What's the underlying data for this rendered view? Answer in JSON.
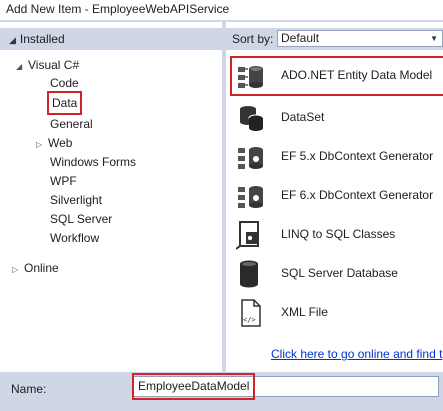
{
  "window": {
    "title": "Add New Item - EmployeeWebAPIService"
  },
  "left_pane": {
    "installed_label": "Installed",
    "tree": {
      "root": "Visual C#",
      "children": [
        "Code",
        "Data",
        "General",
        "Web",
        "Windows Forms",
        "WPF",
        "Silverlight",
        "SQL Server",
        "Workflow"
      ],
      "selected": "Data",
      "online": "Online"
    }
  },
  "right_pane": {
    "sort_label": "Sort by:",
    "sort_value": "Default",
    "templates": [
      {
        "label": "ADO.NET Entity Data Model",
        "icon": "entity-model-icon",
        "selected": true
      },
      {
        "label": "DataSet",
        "icon": "dataset-icon"
      },
      {
        "label": "EF 5.x DbContext Generator",
        "icon": "ef-generator-icon"
      },
      {
        "label": "EF 6.x DbContext Generator",
        "icon": "ef-generator-icon"
      },
      {
        "label": "LINQ to SQL Classes",
        "icon": "linq-icon"
      },
      {
        "label": "SQL Server Database",
        "icon": "database-icon"
      },
      {
        "label": "XML File",
        "icon": "xml-file-icon"
      }
    ],
    "online_link": "Click here to go online and find t"
  },
  "bottom": {
    "name_label": "Name:",
    "name_value": "EmployeeDataModel"
  },
  "colors": {
    "highlight_box": "#d2232a",
    "panel_bg": "#cfd6e5",
    "link": "#0033cc"
  }
}
